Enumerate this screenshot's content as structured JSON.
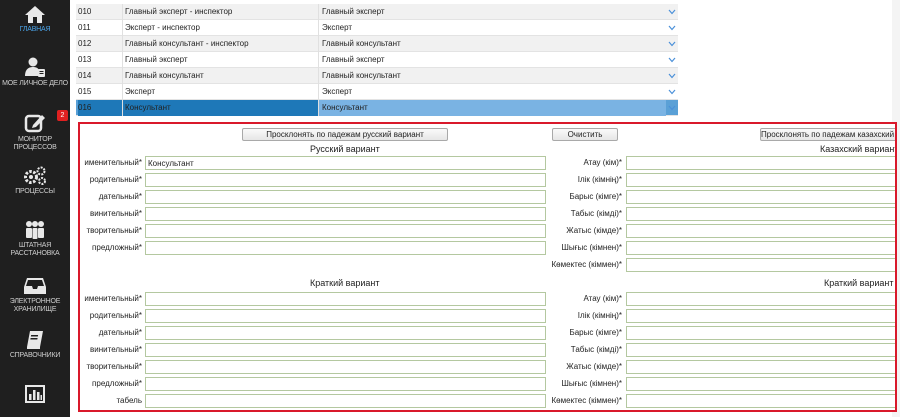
{
  "sidebar": {
    "items": [
      {
        "label": "ГЛАВНАЯ",
        "icon": "home-icon"
      },
      {
        "label": "МОЕ ЛИЧНОЕ ДЕЛО",
        "icon": "user-card-icon"
      },
      {
        "label": "МОНИТОР ПРОЦЕССОВ",
        "icon": "edit-icon",
        "badge": "2"
      },
      {
        "label": "ПРОЦЕССЫ",
        "icon": "gears-icon"
      },
      {
        "label": "ШТАТНАЯ РАССТАНОВКА",
        "icon": "people-icon"
      },
      {
        "label": "ЭЛЕКТРОННОЕ ХРАНИЛИЩЕ",
        "icon": "inbox-icon"
      },
      {
        "label": "СПРАВОЧНИКИ",
        "icon": "book-icon"
      },
      {
        "label": "",
        "icon": "chart-icon"
      }
    ]
  },
  "table": {
    "rows": [
      {
        "code": "010",
        "name": "Главный эксперт - инспектор",
        "value": "Главный эксперт"
      },
      {
        "code": "011",
        "name": "Эксперт - инспектор",
        "value": "Эксперт"
      },
      {
        "code": "012",
        "name": "Главный консультант - инспектор",
        "value": "Главный консультант"
      },
      {
        "code": "013",
        "name": "Главный эксперт",
        "value": "Главный эксперт"
      },
      {
        "code": "014",
        "name": "Главный консультант",
        "value": "Главный консультант"
      },
      {
        "code": "015",
        "name": "Эксперт",
        "value": "Эксперт"
      },
      {
        "code": "016",
        "name": "Консультант",
        "value": "Консультант"
      }
    ]
  },
  "form": {
    "btn_ru": "Просклонять по падежам русский вариант",
    "btn_clear": "Очистить",
    "btn_kz": "Просклонять по падежам казахский вариант",
    "ru_title": "Русский вариант",
    "kz_title": "Казахский вариант",
    "ru_short_title": "Краткий вариант",
    "kz_short_title": "Краткий вариант",
    "ru_fields": [
      {
        "label": "именительный*",
        "value": "Консультант"
      },
      {
        "label": "родительный*",
        "value": ""
      },
      {
        "label": "дательный*",
        "value": ""
      },
      {
        "label": "винительный*",
        "value": ""
      },
      {
        "label": "творительный*",
        "value": ""
      },
      {
        "label": "предложный*",
        "value": ""
      }
    ],
    "kz_fields": [
      {
        "label": "Атау (кім)*",
        "value": ""
      },
      {
        "label": "Ілік (кімнің)*",
        "value": ""
      },
      {
        "label": "Барыс (кімге)*",
        "value": ""
      },
      {
        "label": "Табыс (кімді)*",
        "value": ""
      },
      {
        "label": "Жатыс (кімде)*",
        "value": ""
      },
      {
        "label": "Шығыс (кімнен)*",
        "value": ""
      },
      {
        "label": "Көмектес (кіммен)*",
        "value": ""
      }
    ],
    "ru_short_fields": [
      {
        "label": "именительный*",
        "value": ""
      },
      {
        "label": "родительный*",
        "value": ""
      },
      {
        "label": "дательный*",
        "value": ""
      },
      {
        "label": "винительный*",
        "value": ""
      },
      {
        "label": "творительный*",
        "value": ""
      },
      {
        "label": "предложный*",
        "value": ""
      },
      {
        "label": "табель",
        "value": ""
      }
    ],
    "kz_short_fields": [
      {
        "label": "Атау (кім)*",
        "value": ""
      },
      {
        "label": "Ілік (кімнің)*",
        "value": ""
      },
      {
        "label": "Барыс (кімге)*",
        "value": ""
      },
      {
        "label": "Табыс (кімді)*",
        "value": ""
      },
      {
        "label": "Жатыс (кімде)*",
        "value": ""
      },
      {
        "label": "Шығыс (кімнен)*",
        "value": ""
      },
      {
        "label": "Көмектес (кіммен)*",
        "value": ""
      }
    ]
  },
  "colors": {
    "accent": "#1e78b8",
    "panel_border": "#d9192b",
    "sidebar": "#1f1f1f"
  }
}
